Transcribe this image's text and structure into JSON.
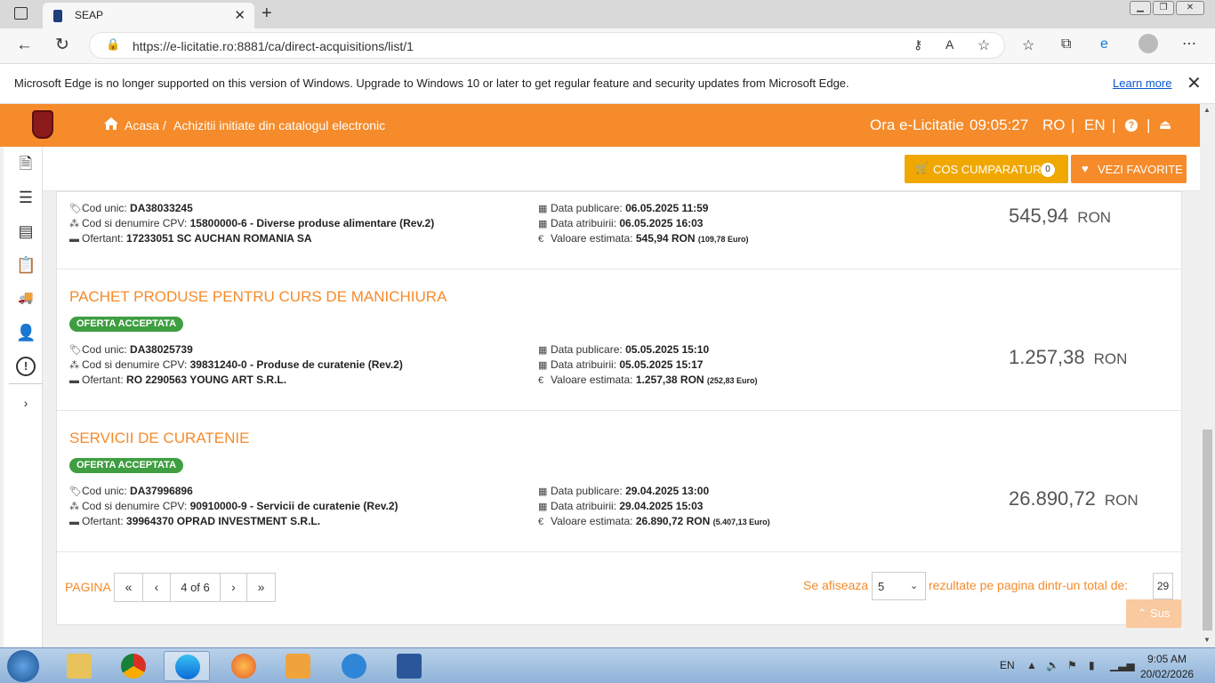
{
  "browser": {
    "tab_title": "SEAP",
    "url": "https://e-licitatie.ro:8881/ca/direct-acquisitions/list/1",
    "notice_text": "Microsoft Edge is no longer supported on this version of Windows. Upgrade to Windows 10 or later to get regular feature and security updates from Microsoft Edge.",
    "learn_more": "Learn more"
  },
  "header": {
    "home": "Acasa",
    "separator": "/",
    "section": "Achizitii initiate din catalogul electronic",
    "clock_label": "Ora e-Licitatie",
    "clock_time": "09:05:27",
    "lang_ro": "RO",
    "lang_en": "EN",
    "divider": "|",
    "help": "?",
    "logout": "⏏"
  },
  "actions": {
    "cart_label": "COS CUMPARATURI",
    "cart_count": "0",
    "favorites_label": "VEZI FAVORITE"
  },
  "labels": {
    "cod_unic": "Cod unic:",
    "cpv": "Cod si denumire CPV:",
    "ofertant": "Ofertant:",
    "data_publicare": "Data publicare:",
    "data_atribuirii": "Data atribuirii:",
    "valoare": "Valoare estimata:",
    "currency": "RON",
    "euro": "Euro"
  },
  "items": [
    {
      "title": "",
      "badge": "",
      "cod": "DA38033245",
      "cpv": "15800000-6 - Diverse produse alimentare (Rev.2)",
      "ofertant": "17233051 SC AUCHAN ROMANIA SA",
      "data_publicare": "06.05.2025 11:59",
      "data_atribuirii": "06.05.2025 16:03",
      "valoare": "545,94",
      "euro": "109,78",
      "price": "545,94"
    },
    {
      "title": "PACHET PRODUSE PENTRU CURS DE MANICHIURA",
      "badge": "OFERTA ACCEPTATA",
      "cod": "DA38025739",
      "cpv": "39831240-0 - Produse de curatenie (Rev.2)",
      "ofertant": "RO 2290563 YOUNG ART S.R.L.",
      "data_publicare": "05.05.2025 15:10",
      "data_atribuirii": "05.05.2025 15:17",
      "valoare": "1.257,38",
      "euro": "252,83",
      "price": "1.257,38"
    },
    {
      "title": "SERVICII DE CURATENIE",
      "badge": "OFERTA ACCEPTATA",
      "cod": "DA37996896",
      "cpv": "90910000-9 - Servicii de curatenie (Rev.2)",
      "ofertant": "39964370 OPRAD INVESTMENT S.R.L.",
      "data_publicare": "29.04.2025 13:00",
      "data_atribuirii": "29.04.2025 15:03",
      "valoare": "26.890,72",
      "euro": "5.407,13",
      "price": "26.890,72"
    }
  ],
  "pagination": {
    "label": "PAGINA",
    "first": "«",
    "prev": "‹",
    "current": "4 of 6",
    "next": "›",
    "last": "»",
    "show_prefix": "Se afiseaza",
    "page_size": "5",
    "show_suffix": "rezultate pe pagina dintr-un total de:",
    "total": "29",
    "back_top": "Sus"
  },
  "taskbar": {
    "lang": "EN",
    "time": "9:05 AM",
    "date": "20/02/2026"
  }
}
